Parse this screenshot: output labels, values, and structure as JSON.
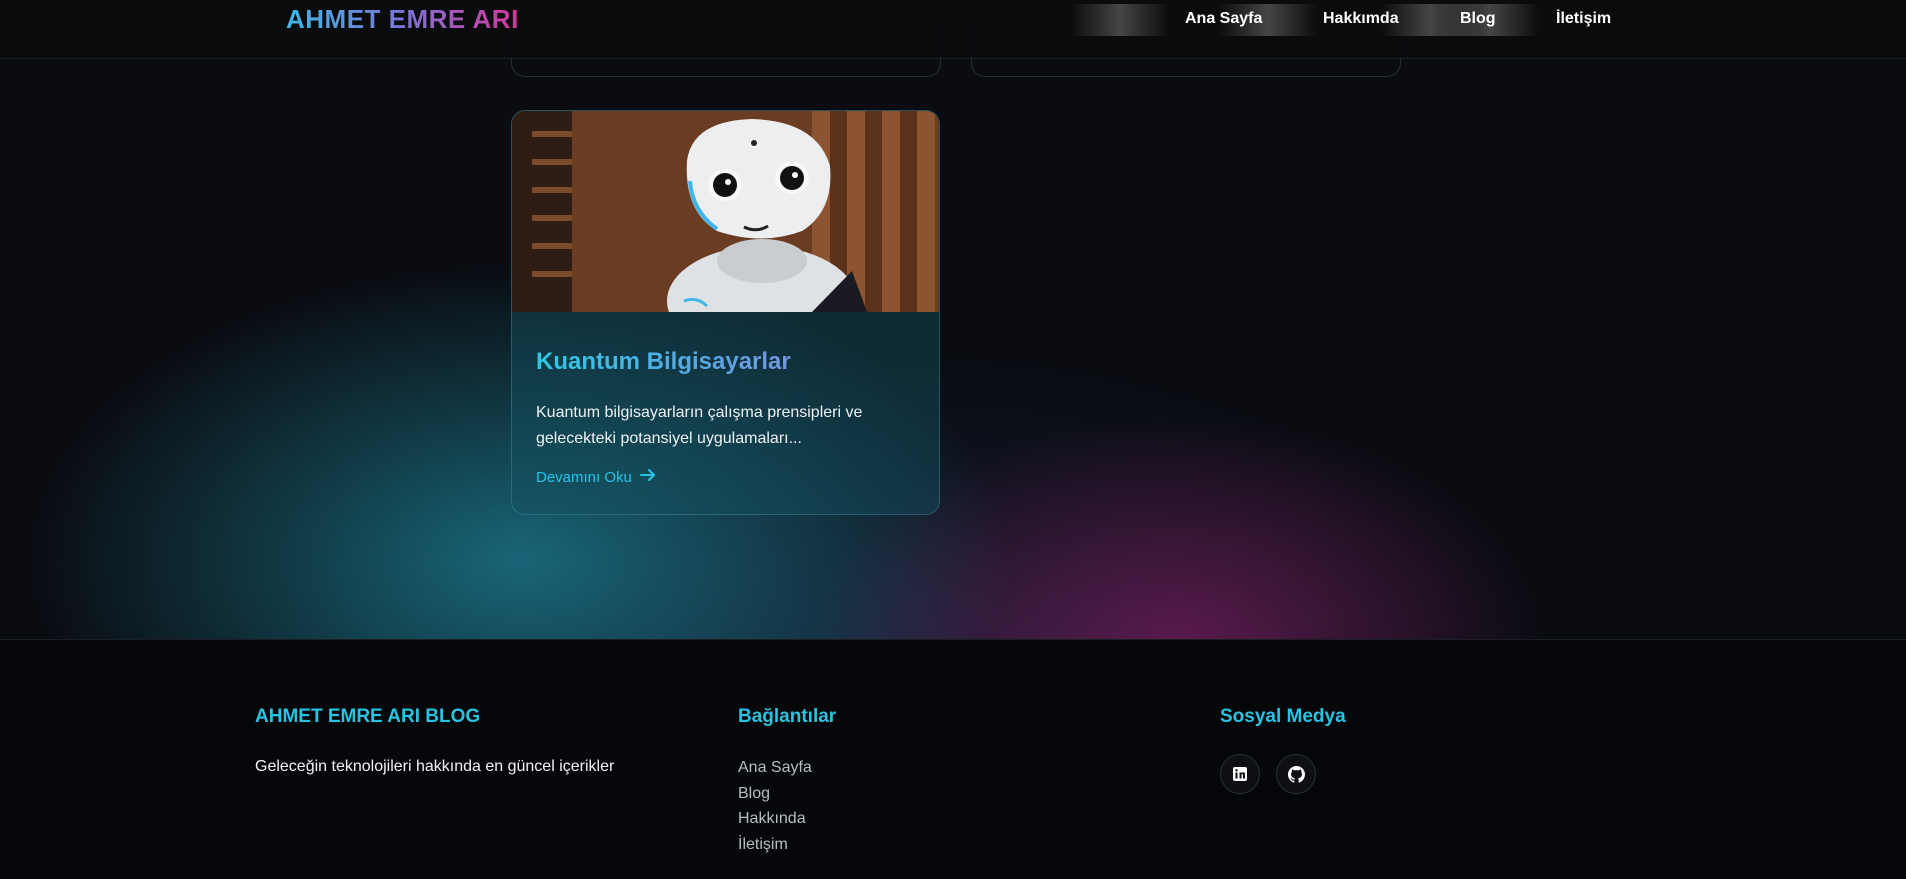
{
  "header": {
    "logo": "AHMET EMRE ARI",
    "nav": [
      "Ana Sayfa",
      "Hakkımda",
      "Blog",
      "İletişim"
    ]
  },
  "post": {
    "image_alt": "robot",
    "title": "Kuantum Bilgisayarlar",
    "excerpt": "Kuantum bilgisayarların çalışma prensipleri ve gelecekteki potansiyel uygulamaları...",
    "read_more": "Devamını Oku",
    "read_more_icon": "arrow-right-icon"
  },
  "footer": {
    "brand": {
      "heading": "AHMET EMRE ARI BLOG",
      "tagline": "Geleceğin teknolojileri hakkında en güncel içerikler"
    },
    "links": {
      "heading": "Bağlantılar",
      "items": [
        "Ana Sayfa",
        "Blog",
        "Hakkında",
        "İletişim"
      ]
    },
    "social": {
      "heading": "Sosyal Medya",
      "icons": [
        "linkedin-icon",
        "github-icon"
      ]
    }
  },
  "colors": {
    "accent": "#22c6e4",
    "logo_gradient": [
      "#3fb6e8",
      "#7b74d4",
      "#d6359a"
    ],
    "background": "#07080c"
  }
}
